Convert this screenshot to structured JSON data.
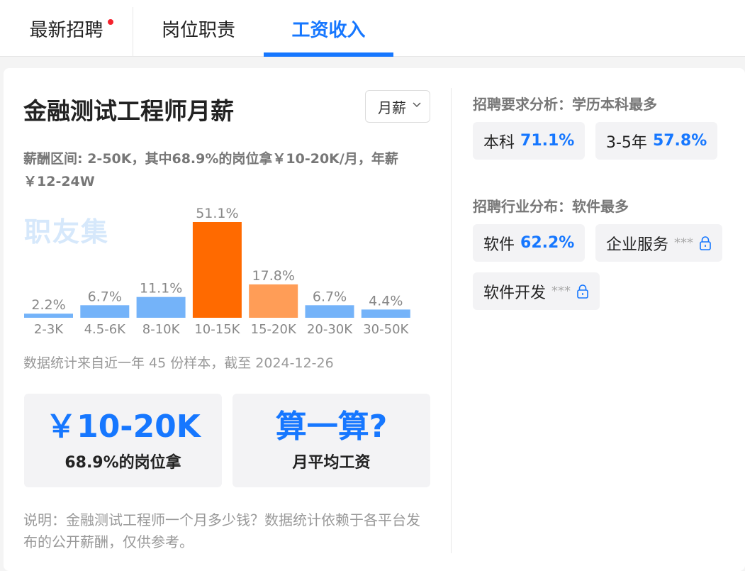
{
  "tabs": [
    {
      "label": "最新招聘"
    },
    {
      "label": "岗位职责"
    },
    {
      "label": "工资收入"
    }
  ],
  "colors": {
    "accent": "#1677ff",
    "bar": "#74b3f9",
    "bar_highlight": "#ff6a00",
    "bar_second": "#ff9d57",
    "notification": "#f5222d"
  },
  "main": {
    "title": "金融测试工程师月薪",
    "period_select": "月薪",
    "summary": "薪酬区间: 2-50K，其中68.9%的岗位拿￥10-20K/月，年薪￥12-24W",
    "watermark": "职友集",
    "stat_note": "数据统计来自近一年 45 份样本，截至 2024-12-26",
    "box1": {
      "value": "￥10-20K",
      "label": "68.9%的岗位拿"
    },
    "box2": {
      "value": "算一算?",
      "label": "月平均工资"
    },
    "footnote": "说明：金融测试工程师一个月多少钱？数据统计依赖于各平台发布的公开薪酬，仅供参考。"
  },
  "chart_data": {
    "type": "bar",
    "categories": [
      "2-3K",
      "4.5-6K",
      "8-10K",
      "10-15K",
      "15-20K",
      "20-30K",
      "30-50K"
    ],
    "values": [
      2.2,
      6.7,
      11.1,
      51.1,
      17.8,
      6.7,
      4.4
    ],
    "value_labels": [
      "2.2%",
      "6.7%",
      "11.1%",
      "51.1%",
      "17.8%",
      "6.7%",
      "4.4%"
    ],
    "highlight_index": 3,
    "second_index": 4,
    "grid": false,
    "legend": "none"
  },
  "sidebar": {
    "requirements_title": "招聘要求分析：学历本科最多",
    "requirements": [
      {
        "name": "本科",
        "pct": "71.1%"
      },
      {
        "name": "3-5年",
        "pct": "57.8%"
      }
    ],
    "industry_title": "招聘行业分布：软件最多",
    "industries": [
      {
        "name": "软件",
        "pct": "62.2%"
      },
      {
        "name": "企业服务",
        "mask": "***",
        "icon": "lock-icon"
      },
      {
        "name": "软件开发",
        "mask": "***",
        "icon": "lock-icon"
      }
    ]
  }
}
